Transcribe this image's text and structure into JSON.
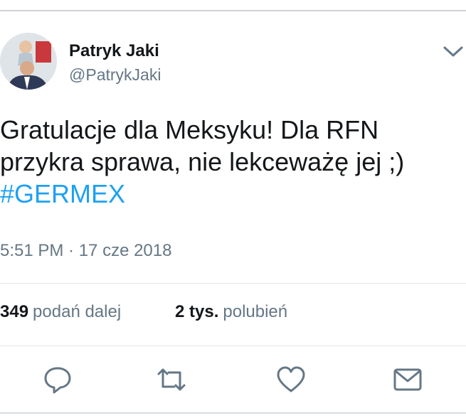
{
  "tweet": {
    "author_name": "Patryk Jaki",
    "handle": "@PatrykJaki",
    "text_line_1": "Gratulacje dla Meksyku! Dla RFN",
    "text_line_2": "przykra sprawa, nie lekceważę jej ;)",
    "hashtag": "#GERMEX",
    "timestamp": "5:51 PM · 17 cze 2018",
    "retweets_count": "349",
    "retweets_label": "podań dalej",
    "likes_count": "2 tys.",
    "likes_label": "polubień"
  },
  "icons": {
    "menu": "chevron-down-icon",
    "reply": "reply-icon",
    "retweet": "retweet-icon",
    "like": "heart-icon",
    "direct_message": "envelope-icon"
  },
  "colors": {
    "text": "#14171a",
    "secondary": "#657786",
    "link": "#1da1f2",
    "divider": "#e1e8ed"
  }
}
